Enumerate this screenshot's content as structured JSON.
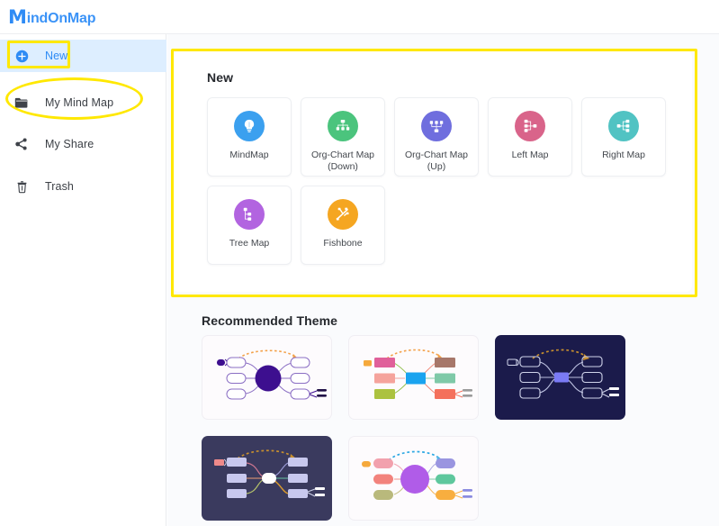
{
  "app": {
    "logo_m": "M",
    "logo_rest": "indOnMap"
  },
  "sidebar": {
    "items": [
      {
        "id": "new",
        "label": "New",
        "icon": "plus-circle-icon",
        "active": true
      },
      {
        "id": "mymindmap",
        "label": "My Mind Map",
        "icon": "folder-icon",
        "active": false
      },
      {
        "id": "myshare",
        "label": "My Share",
        "icon": "share-icon",
        "active": false
      },
      {
        "id": "trash",
        "label": "Trash",
        "icon": "trash-icon",
        "active": false
      }
    ]
  },
  "main": {
    "new_section": {
      "title": "New",
      "cards": [
        {
          "label": "MindMap",
          "icon": "lightbulb-icon",
          "color": "#3ba0ef"
        },
        {
          "label": "Org-Chart Map (Down)",
          "icon": "org-chart-down-icon",
          "color": "#4bc47d"
        },
        {
          "label": "Org-Chart Map (Up)",
          "icon": "org-chart-up-icon",
          "color": "#6f6ede"
        },
        {
          "label": "Left Map",
          "icon": "left-map-icon",
          "color": "#d9648a"
        },
        {
          "label": "Right Map",
          "icon": "right-map-icon",
          "color": "#51c3c3"
        },
        {
          "label": "Tree Map",
          "icon": "tree-map-icon",
          "color": "#b264e0"
        },
        {
          "label": "Fishbone",
          "icon": "fishbone-icon",
          "color": "#f5a621"
        }
      ]
    },
    "theme_section": {
      "title": "Recommended Theme",
      "themes": [
        {
          "id": "theme-violet-light",
          "style": "light",
          "background": "#fdfbfd",
          "accent": "#3d0f8f"
        },
        {
          "id": "theme-colorful",
          "style": "light",
          "background": "#fdfbfd",
          "accent": "#1aa3ef"
        },
        {
          "id": "theme-navy",
          "style": "dark",
          "background": "#1b1b4b",
          "accent": "#7b7bf5"
        },
        {
          "id": "theme-slate",
          "style": "dark",
          "background": "#3a3a5e",
          "accent": "#ffffff"
        },
        {
          "id": "theme-purple-light",
          "style": "light",
          "background": "#fdfbfd",
          "accent": "#b05ce8"
        }
      ]
    }
  },
  "annotations": {
    "highlight_color": "#ffe800",
    "shapes": [
      {
        "name": "new-button-highlight",
        "type": "rect"
      },
      {
        "name": "my-mind-map-highlight",
        "type": "ellipse"
      },
      {
        "name": "new-panel-highlight",
        "type": "rect"
      }
    ]
  }
}
